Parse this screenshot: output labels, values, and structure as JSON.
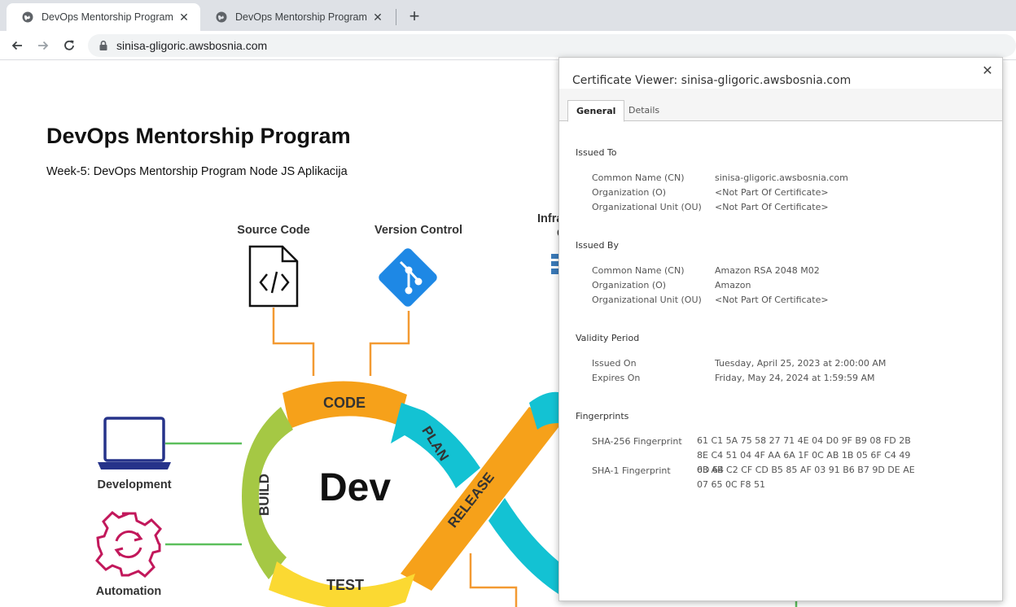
{
  "browser": {
    "tabs": [
      {
        "title": "DevOps Mentorship Program",
        "active": true
      },
      {
        "title": "DevOps Mentorship Program",
        "active": false
      }
    ],
    "close_glyph": "✕",
    "new_tab_glyph": "+",
    "url": "sinisa-gligoric.awsbosnia.com"
  },
  "page": {
    "title": "DevOps Mentorship Program",
    "subtitle": "Week-5: DevOps Mentorship Program Node JS Aplikacija",
    "diagram": {
      "labels": {
        "source_code": "Source Code",
        "version_control": "Version Control",
        "infra_partial": "Infra",
        "infra_partial_line2": "C",
        "development": "Development",
        "automation": "Automation",
        "center": "Dev"
      },
      "segments": {
        "code": "CODE",
        "plan": "PLAN",
        "build": "BUILD",
        "release": "RELEASE",
        "test": "TEST"
      },
      "colors": {
        "code": "#f6a11a",
        "plan": "#13c2d3",
        "build": "#a5c844",
        "release": "#f6a11a",
        "test": "#fbd932",
        "connector": "#f39a32",
        "green_connector": "#5cbf5c",
        "laptop": "#26338a",
        "gear": "#c2185b",
        "git": "#1e88e5"
      }
    }
  },
  "cert": {
    "title": "Certificate Viewer: sinisa-gligoric.awsbosnia.com",
    "close_glyph": "✕",
    "tabs": {
      "general": "General",
      "details": "Details"
    },
    "issued_to": {
      "heading": "Issued To",
      "rows": [
        {
          "label": "Common Name (CN)",
          "value": "sinisa-gligoric.awsbosnia.com"
        },
        {
          "label": "Organization (O)",
          "value": "<Not Part Of Certificate>"
        },
        {
          "label": "Organizational Unit (OU)",
          "value": "<Not Part Of Certificate>"
        }
      ]
    },
    "issued_by": {
      "heading": "Issued By",
      "rows": [
        {
          "label": "Common Name (CN)",
          "value": "Amazon RSA 2048 M02"
        },
        {
          "label": "Organization (O)",
          "value": "Amazon"
        },
        {
          "label": "Organizational Unit (OU)",
          "value": "<Not Part Of Certificate>"
        }
      ]
    },
    "validity": {
      "heading": "Validity Period",
      "rows": [
        {
          "label": "Issued On",
          "value": "Tuesday, April 25, 2023 at 2:00:00 AM"
        },
        {
          "label": "Expires On",
          "value": "Friday, May 24, 2024 at 1:59:59 AM"
        }
      ]
    },
    "fingerprints": {
      "heading": "Fingerprints",
      "rows": [
        {
          "label": "SHA-256 Fingerprint",
          "value": "61 C1 5A 75 58 27 71 4E 04 D0 9F B9 08 FD 2B 8E C4 51 04 4F AA 6A 1F 0C AB 1B 05 6F C4 49 0D 64"
        },
        {
          "label": "SHA-1 Fingerprint",
          "value": "63 AB C2 CF CD B5 85 AF 03 91 B6 B7 9D DE AE 07 65 0C F8 51"
        }
      ]
    }
  }
}
